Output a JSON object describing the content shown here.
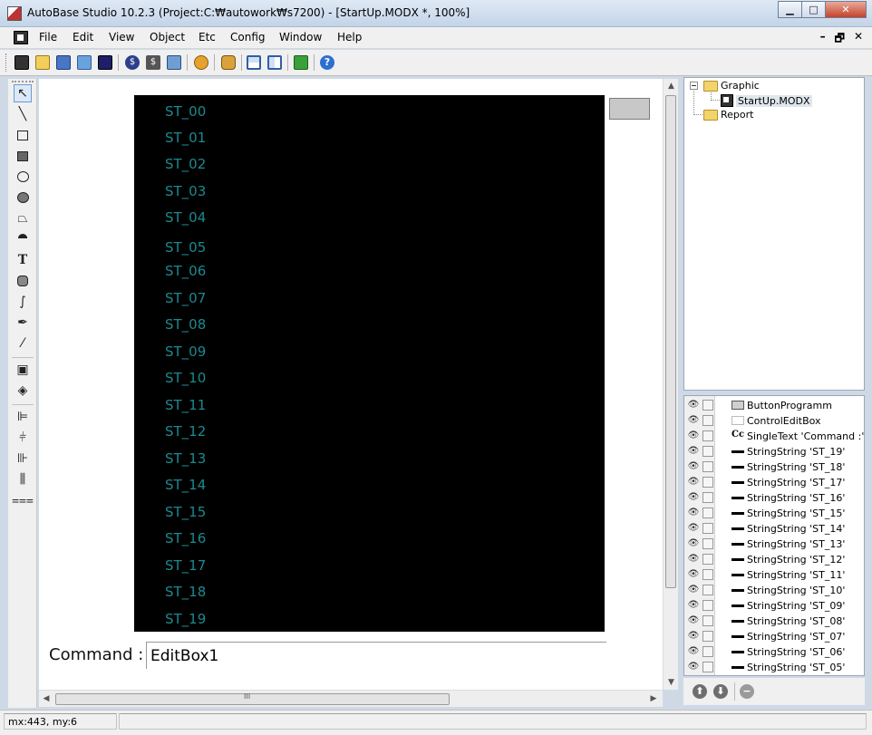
{
  "window": {
    "title": "AutoBase Studio 10.2.3 (Project:C:₩autowork₩s7200) - [StartUp.MODX *, 100%]",
    "minimize_glyph": "▁",
    "maximize_glyph": "□",
    "close_glyph": "✕"
  },
  "menu": {
    "items": [
      "File",
      "Edit",
      "View",
      "Object",
      "Etc",
      "Config",
      "Window",
      "Help"
    ],
    "mdi_restore": "🗗",
    "mdi_minimize": "–",
    "mdi_close": "✕"
  },
  "toolbar": {
    "icons": [
      "new-document-icon",
      "open-folder-icon",
      "save-all-icon",
      "open-icon",
      "save-icon",
      "dollar-icon",
      "dollar-dark-icon",
      "properties-icon",
      "tag-icon",
      "object-settings-icon",
      "layout-horizontal-icon",
      "layout-vertical-icon",
      "refresh-icon",
      "help-icon"
    ]
  },
  "palette": {
    "tools": [
      "select-arrow-icon",
      "line-icon",
      "rectangle-icon",
      "filled-rectangle-icon",
      "ellipse-icon",
      "filled-ellipse-icon",
      "polygon-icon",
      "filled-polygon-icon",
      "text-tool-icon",
      "rounded-rect-icon",
      "curve-icon",
      "pen-icon",
      "eyedropper-icon",
      "group-icon",
      "ungroup-icon",
      "align-left-icon",
      "align-center-icon",
      "align-right-icon",
      "distribute-horizontal-icon",
      "distribute-vertical-icon"
    ]
  },
  "canvas": {
    "panel_color": "#000000",
    "label_color": "#1b8a8f",
    "st_labels": [
      "ST_00",
      "ST_01",
      "ST_02",
      "ST_03",
      "ST_04",
      "ST_05",
      "ST_06",
      "ST_07",
      "ST_08",
      "ST_09",
      "ST_10",
      "ST_11",
      "ST_12",
      "ST_13",
      "ST_14",
      "ST_15",
      "ST_16",
      "ST_17",
      "ST_18",
      "ST_19"
    ],
    "command_label": "Command :",
    "command_value": "EditBox1"
  },
  "scroll": {
    "h_grip": "III",
    "v_grip": "≡"
  },
  "tree": {
    "root_expander": "⊟",
    "graphic": "Graphic",
    "startup": "StartUp.MODX",
    "report": "Report"
  },
  "layers": {
    "rows": [
      "ButtonProgramm",
      "ControlEditBox",
      "SingleText 'Command :'",
      "StringString 'ST_19'",
      "StringString 'ST_18'",
      "StringString 'ST_17'",
      "StringString 'ST_16'",
      "StringString 'ST_15'",
      "StringString 'ST_14'",
      "StringString 'ST_13'",
      "StringString 'ST_12'",
      "StringString 'ST_11'",
      "StringString 'ST_10'",
      "StringString 'ST_09'",
      "StringString 'ST_08'",
      "StringString 'ST_07'",
      "StringString 'ST_06'",
      "StringString 'ST_05'"
    ],
    "thumb_kinds": [
      "button",
      "editbox",
      "text",
      "string",
      "string",
      "string",
      "string",
      "string",
      "string",
      "string",
      "string",
      "string",
      "string",
      "string",
      "string",
      "string",
      "string",
      "string"
    ]
  },
  "layer_tools": {
    "up": "⬆",
    "down": "⬇",
    "remove": "−"
  },
  "status": {
    "coords": "mx:443, my:6",
    "cell2": ""
  }
}
